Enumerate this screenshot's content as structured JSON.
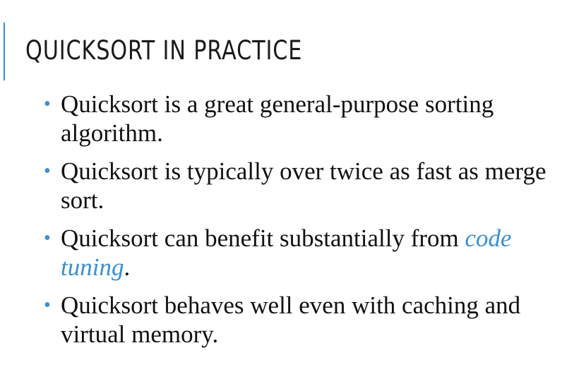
{
  "slide": {
    "title": "QUICKSORT IN PRACTICE",
    "bullets": [
      {
        "text": "Quicksort is a great general-purpose sorting algorithm."
      },
      {
        "text": "Quicksort is typically over twice as fast as merge sort."
      },
      {
        "text_before": "Quicksort can benefit substantially from ",
        "link": "code tuning",
        "text_after": "."
      },
      {
        "text": "Quicksort behaves well even with caching and virtual memory."
      }
    ],
    "bullet_symbol": "•"
  },
  "colors": {
    "accent": "#3a8fd1",
    "text": "#111111"
  }
}
